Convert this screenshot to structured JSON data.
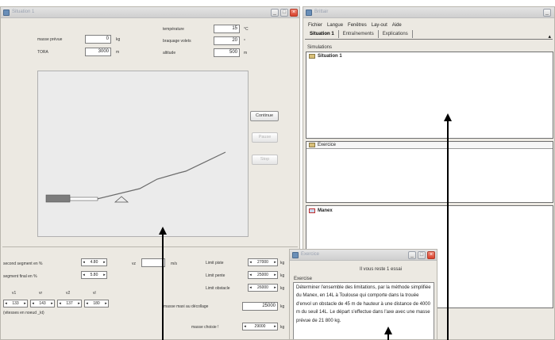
{
  "left_window": {
    "title": "Situation 1",
    "fields": {
      "masse_prevue_label": "masse prévue",
      "masse_prevue_value": "0",
      "masse_prevue_unit": "kg",
      "tora_label": "TORA",
      "tora_value": "3000",
      "tora_unit": "m",
      "temperature_label": "température",
      "temperature_value": "15",
      "temperature_unit": "°C",
      "braquage_label": "braquage volets",
      "braquage_value": "20",
      "braquage_unit": "°",
      "altitude_label": "altitude",
      "altitude_value": "500",
      "altitude_unit": "m"
    },
    "buttons": {
      "continue": "Continue",
      "pause": "Pause",
      "stop": "Stop"
    },
    "lower": {
      "second_segment_label": "second segment en %",
      "second_segment_value": "4.80",
      "final_segment_label": "segment final en %",
      "final_segment_value": "5.80",
      "vz_label": "vz",
      "vz_value": "",
      "vz_unit": "m/s",
      "speed_headers": [
        "v1",
        "vr",
        "v2",
        "vl"
      ],
      "speed_values": [
        "133",
        "143",
        "137",
        "180"
      ],
      "speed_note": "(vitesses en noeud _kt)",
      "limit_piste_label": "Limit piste",
      "limit_piste_value": "27000",
      "limit_pente_label": "Limit pente",
      "limit_pente_value": "25000",
      "limit_obstacle_label": "Limit obstacle",
      "limit_obstacle_value": "26000",
      "kg": "kg",
      "masse_maxi_label": "masse maxi au décollage",
      "masse_maxi_value": "25000",
      "masse_choisie_label": "masse choisie !",
      "masse_choisie_value": "29000"
    }
  },
  "right_window": {
    "title": "Brittair",
    "menu": [
      "Fichier",
      "Langue",
      "Fenêtres",
      "Lay-out",
      "Aide"
    ],
    "tabs": [
      "Situation 1",
      "Entraînements",
      "Explications"
    ],
    "simulations_label": "Simulations",
    "situation_item": "Situation 1",
    "exercice_label": "Exercice",
    "manex_label": "Manex"
  },
  "exercise_window": {
    "title": "Exercice",
    "remaining": "Il vous reste 1 essai",
    "heading": "Exercise",
    "text": "Déterminer l'ensemble des limitations, par la méthode simplifiée du Manex, en 14L à Toulouse qui comporte dans la trouée d'envol un obstacle de 45 m de hauteur à une distance de 4000 m du seuil 14L. Le départ s'effectue dans l'axe avec une masse prévue de 21 800 kg."
  },
  "colors": {
    "window_bg": "#ece9e2",
    "close_button": "#d9402a",
    "arrow": "#000000"
  }
}
